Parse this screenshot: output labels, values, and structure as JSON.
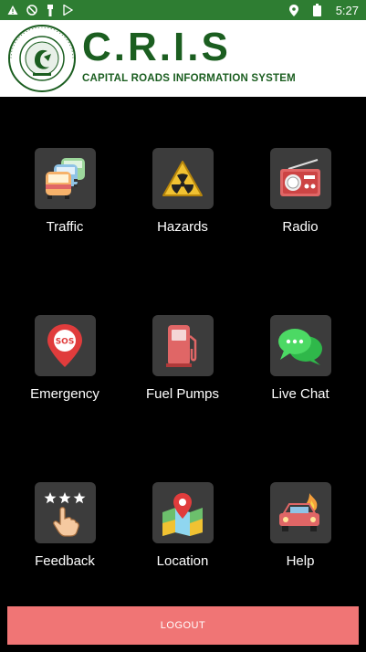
{
  "status_bar": {
    "time": "5:27",
    "icons": [
      "warning-icon",
      "do-not-disturb-icon",
      "usb-icon",
      "play-store-icon",
      "location-icon",
      "battery-icon"
    ]
  },
  "header": {
    "title": "C.R.I.S",
    "subtitle": "CAPITAL ROADS INFORMATION SYSTEM",
    "logo": {
      "ring_top": "CAPITAL DEVELOPMENT AUTHORITY",
      "ring_bottom": "ISLAMABAD"
    },
    "brand_color": "#1b5e20"
  },
  "menu": [
    {
      "label": "Traffic",
      "icon": "traffic-icon"
    },
    {
      "label": "Hazards",
      "icon": "hazard-icon"
    },
    {
      "label": "Radio",
      "icon": "radio-icon"
    },
    {
      "label": "Emergency",
      "icon": "sos-icon"
    },
    {
      "label": "Fuel Pumps",
      "icon": "fuel-pump-icon"
    },
    {
      "label": "Live Chat",
      "icon": "chat-icon"
    },
    {
      "label": "Feedback",
      "icon": "feedback-icon"
    },
    {
      "label": "Location",
      "icon": "map-pin-icon"
    },
    {
      "label": "Help",
      "icon": "car-accident-icon"
    }
  ],
  "logout": {
    "label": "LOGOUT",
    "color": "#f07575"
  }
}
